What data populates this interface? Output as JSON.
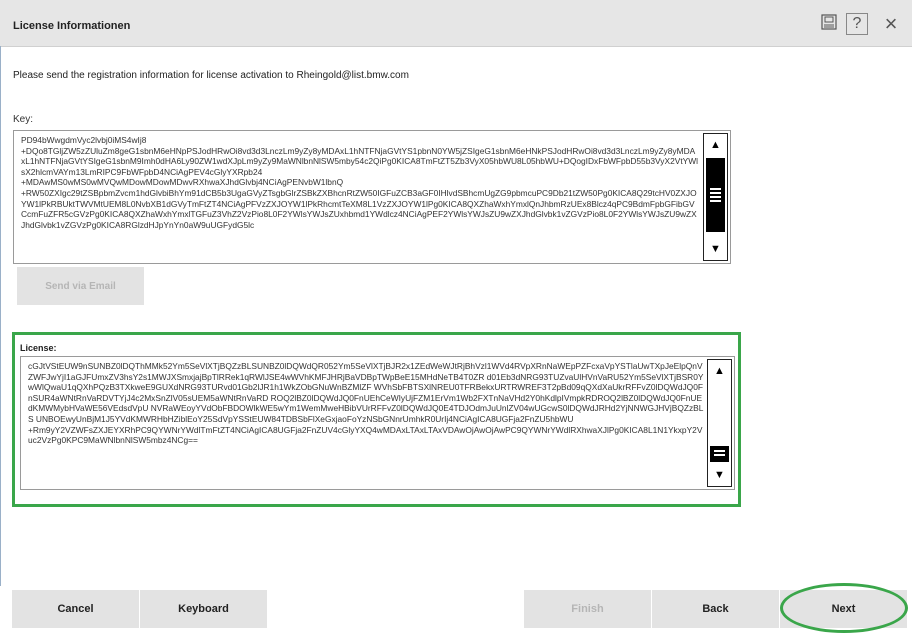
{
  "window": {
    "title": "License Informationen",
    "buttons": {
      "print_icon": "printer-icon",
      "help_label": "?",
      "close_label": "×"
    }
  },
  "instruction": "Please send the registration information for license activation to Rheingold@list.bmw.com",
  "key": {
    "label": "Key:",
    "text": "PD94bWwgdmVyc2lvbj0iMS4wIj8\n+DQo8TGljZW5zZUluZm8geG1sbnM6eHNpPSJodHRwOi8vd3d3LnczLm9yZy8yMDAxL1hNTFNjaGVtYS1pbnN0YW5jZSIgeG1sbnM6eHNkPSJodHRwOi8vd3d3LnczLm9yZy8yMDAxL1hNTFNjaGVtYSIgeG1sbnM9Imh0dHA6Ly90ZW1wdXJpLm9yZy9MaWNlbnNlSW5mby54c2QiPg0KICA8TmFtZT5Zb3VyX05hbWU8L05hbWU+DQogIDxFbWFpbD55b3VyX2VtYWlsX2hlcmVAYm13LmRIPC9FbWFpbD4NCiAgPEV4cGlyYXRpb24\n+MDAwMS0wMS0wMVQwMDowMDowMDwvRXhwaXJhdGlvbj4NCiAgPENvbW1lbnQ\n+RW50ZXIgc29tZSBpbmZvcm1hdGlvbiBhYm91dCB5b3UgaGVyZTsgbGlrZSBkZXBhcnRtZW50IGFuZCB3aGF0IHlvdSBhcmUgZG9pbmcuPC9Db21tZW50Pg0KICA8Q29tcHV0ZXJOYW1lPkRBUktTWVMtUEM8L0NvbXB1dGVyTmFtZT4NCiAgPFVzZXJOYW1lPkRhcmtTeXM8L1VzZXJOYW1lPg0KICA8QXZhaWxhYmxlQnJhbmRzUEx8Blcz4qPC9BdmFpbGFibGVCcmFuZFR5cGVzPg0KICA8QXZhaWxhYmxlTGFuZ3VhZ2VzPio8L0F2YWlsYWJsZUxhbmd1YWdlcz4NCiAgPEF2YWlsYWJsZU9wZXJhdGlvbk1vZGVzPio8L0F2YWlsYWJsZU9wZXJhdGlvbk1vZGVzPg0KICA8RGlzdHJpYnYn0aW9uUGFydG5lc"
  },
  "send_button_label": "Send via Email",
  "license": {
    "label": "License:",
    "text": "cGJtVStEUW9nSUNBZ0lDQThMMk52Ym5SeVlXTjBQZzBLSUNBZ0lDQWdQR052Ym5SeVlXTjBJR2x1ZEdWeWJtRjBhVzl1WVd4RVpXRnNaWEpPZFcxaVpYSTlaUwTXpJeElpQnVZWFJwYjI1aGJFUmxZV3hsY2s1MWJXSmxjajBpTlRRek1qRWlJSE4wWVhKMFJHRjBaVDBpTWpBeE15MHdNeTB4T0ZR d01Eb3dNRG93TUZvaUlHVnVaRU52Ym5SeVlXTjBSR0YwWlQwaU1qQXhPQzB3TXkweE9GUXdNRG93TURvd01Gb2lJR1h1WkZObGNuWnBZMlZF WVhSbFBTSXlNREU0TFRBekxURTRWREF3T2pBd09qQXdXaUkrRFFvZ0lDQWdJQ0FnSUR4aWNtRnVaRDVTYjJ4c2MxSnZlV05sUEM5aWNtRnVaRD ROQ2lBZ0lDQWdJQ0FnUEhCeWIyUjFZM1ErVm1Wb2FXTnNaVHd2Y0hKdlpIVmpkRDROQ2lBZ0lDQWdJQ0FnUEdKMWMybHVaWE56VEdsdVpU NVRaWEoyYVdObFBDOWlkWE5wYm1WemMweHBibVUrRFFvZ0lDQWdJQ0E4TDJOdmJuUnlZV04wUGcwS0lDQWdJRHd2YjNNWGJHVjBQZzBLS UNBOEwyUnBjM1J5YVdKMWRHbHZiblEoY25SdVpYSStEUW84TDBSbFlXeGxjaoFoYzNSbGNnrUmhkR0UrIj4NCiAgICA8UGFja2FnZU5hbWU\n+Rm9yY2VZWFsZXJEYXRhPC9QYWNrYWdlTmFtZT4NCiAgICA8UGFja2FnZUV4cGlyYXQ4wMDAxLTAxLTAxVDAwOjAwOjAwPC9QYWNrYWdlRXhwaXJlPg0KICA8L1N1YkxpY2Vuc2VzPg0KPC9MaWNlbnNlSW5mbz4NCg=="
  },
  "footer": {
    "cancel": "Cancel",
    "keyboard": "Keyboard",
    "finish": "Finish",
    "back": "Back",
    "next": "Next"
  }
}
